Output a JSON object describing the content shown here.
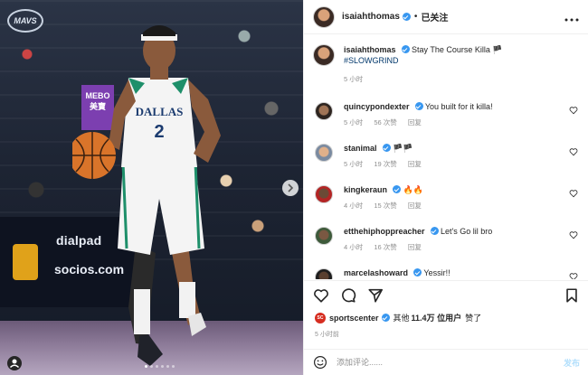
{
  "photo": {
    "team_logo_text": "MAVS",
    "jersey_team": "DALLAS",
    "jersey_number": "2",
    "board_text_1": "dialpad",
    "board_text_2": "socios.com",
    "mebo_text": "MEBO 美寶",
    "carousel_dots": 6,
    "active_dot": 1
  },
  "header": {
    "username": "isaiahthomas",
    "separator": "•",
    "follow_status": "已关注",
    "more_icon": "more-horizontal-icon"
  },
  "caption": {
    "username": "isaiahthomas",
    "text": "Stay The Course Killa 🏴",
    "hashtag": "#SLOWGRIND",
    "time": "5 小时"
  },
  "comments": [
    {
      "username": "quincypondexter",
      "text": "You built for it killa!",
      "time": "5 小时",
      "likes": "56 次赞",
      "reply": "回复"
    },
    {
      "username": "stanimal",
      "text": "🏴🏴",
      "time": "5 小时",
      "likes": "19 次赞",
      "reply": "回复"
    },
    {
      "username": "kingkeraun",
      "text": "🔥🔥",
      "time": "4 小时",
      "likes": "15 次赞",
      "reply": "回复"
    },
    {
      "username": "etthehiphoppreacher",
      "text": "Let's Go lil bro",
      "time": "4 小时",
      "likes": "16 次赞",
      "reply": "回复"
    },
    {
      "username": "marcelashoward",
      "text": "Yessir!!",
      "time": "",
      "likes": "",
      "reply": ""
    }
  ],
  "likes": {
    "avatar_label": "SC",
    "user": "sportscenter",
    "others_prefix": "其他",
    "others_count": "11.4万 位用户",
    "suffix": "赞了"
  },
  "post_time": "5 小时前",
  "add_comment": {
    "placeholder": "添加评论......",
    "post_label": "发布"
  },
  "colors": {
    "verified": "#3897f0",
    "link": "#00376b",
    "muted": "#8e8e8e",
    "post_button": "#b2dffc"
  }
}
